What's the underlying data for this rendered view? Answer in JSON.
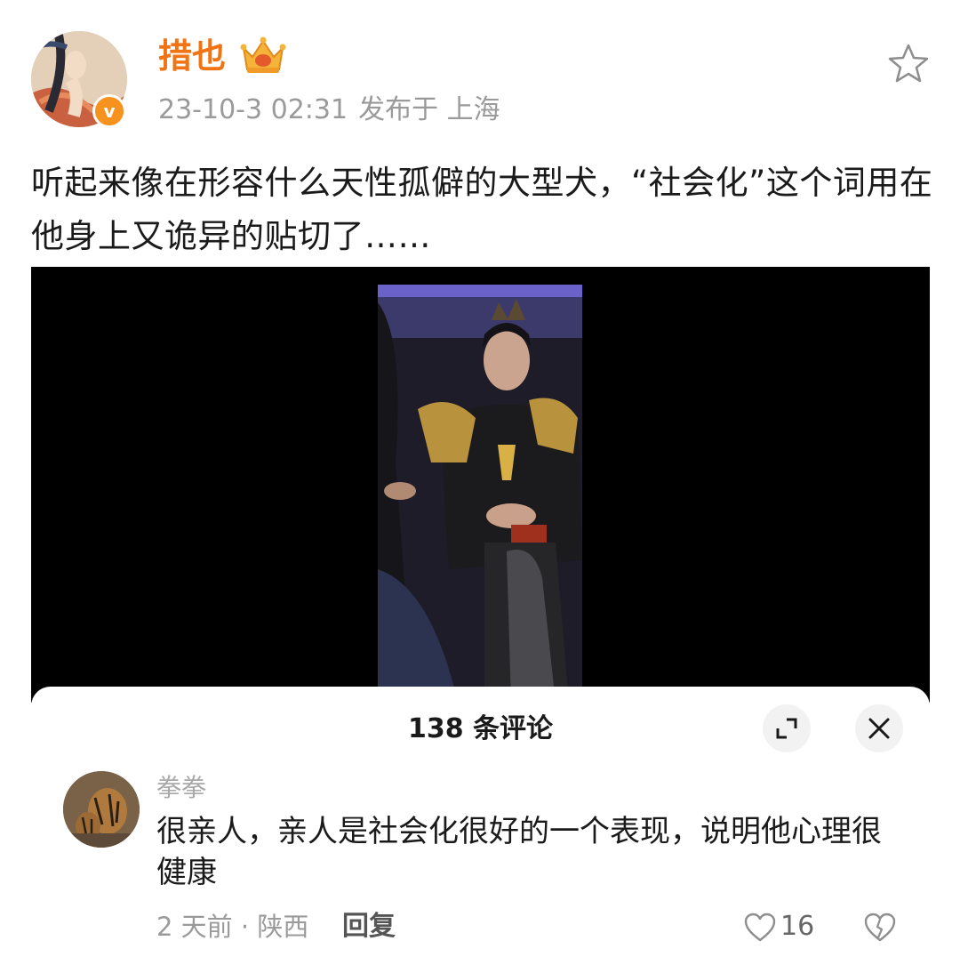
{
  "post": {
    "author": "措也",
    "date": "23-10-3 02:31",
    "location_label": "发布于 上海",
    "text": "听起来像在形容什么天性孤僻的大型犬，“社会化”这个词用在他身上又诡异的贴切了……",
    "icons": {
      "avatar": "painted-figure-avatar",
      "verified": "verified-badge-icon",
      "verified_glyph": "v",
      "crown": "crown-membership-icon",
      "favorite": "star-icon"
    },
    "colors": {
      "author_name": "#f07414",
      "verified_badge": "#f7921e"
    }
  },
  "media": {
    "description_icon": "video-still-image"
  },
  "comments_panel": {
    "title": "138 条评论",
    "expand_icon": "expand-icon",
    "close_icon": "close-icon",
    "comments": [
      {
        "user": "拳拳",
        "text": "很亲人，亲人是社会化很好的一个表现，说明他心理很健康",
        "time_location": "2 天前 · 陕西",
        "reply_label": "回复",
        "likes": "16",
        "like_icon": "heart-icon",
        "dislike_icon": "broken-heart-icon"
      }
    ]
  }
}
